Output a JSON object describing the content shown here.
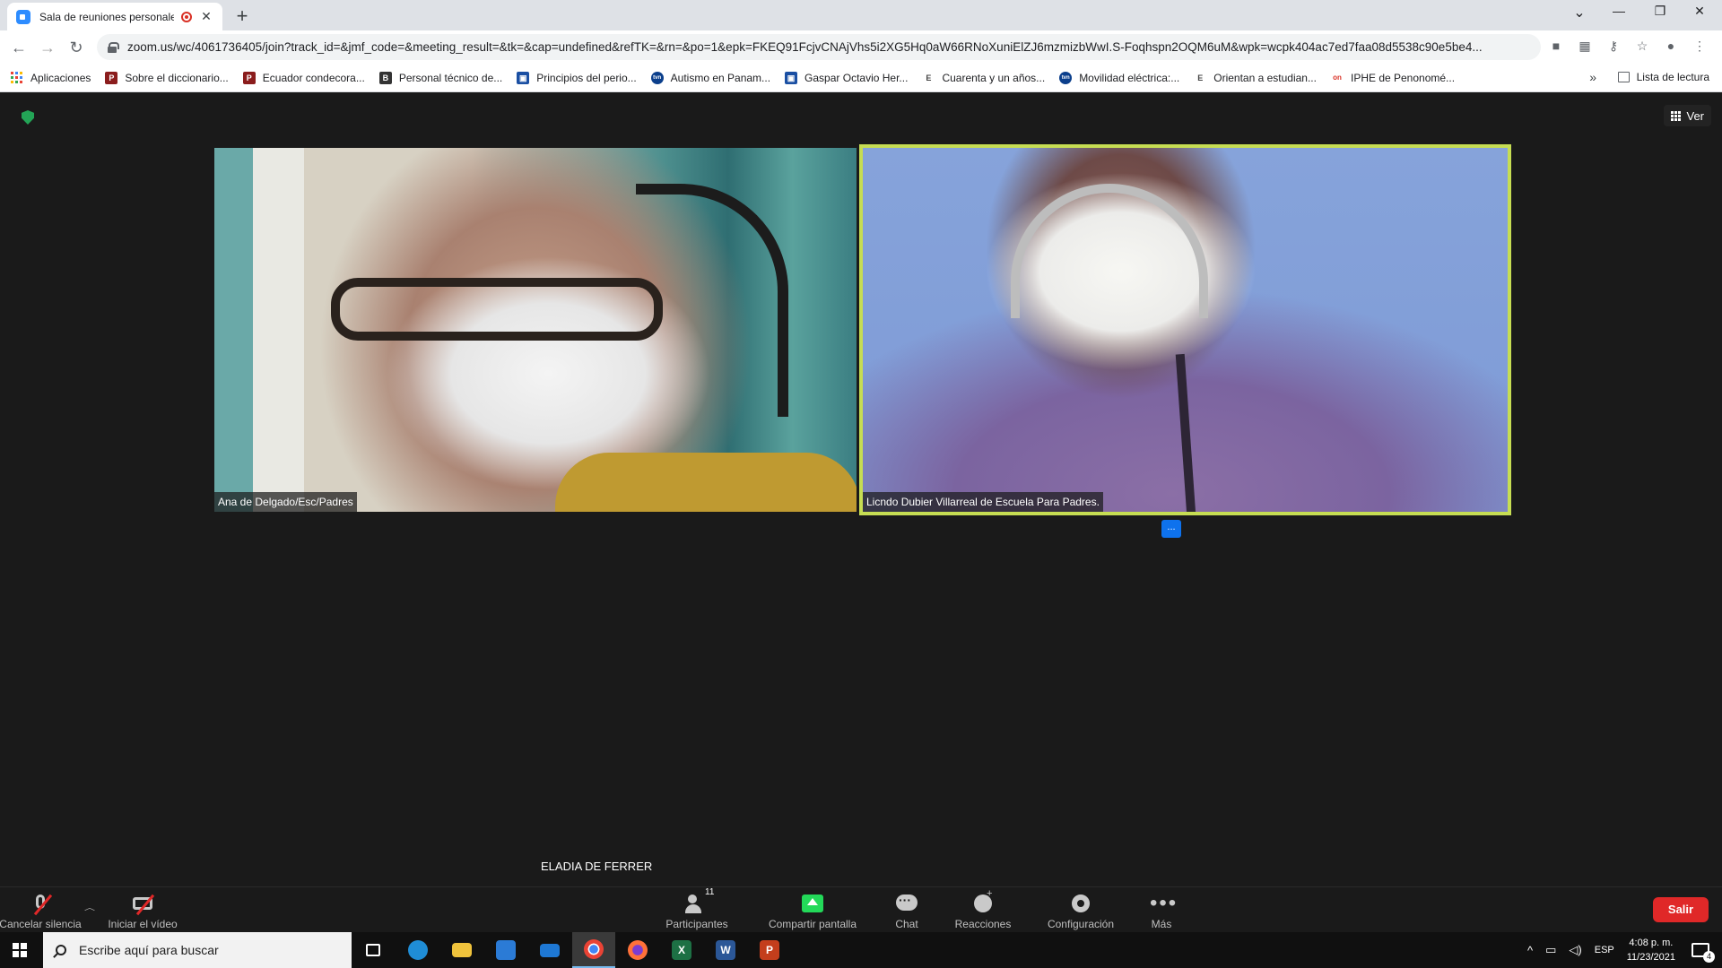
{
  "browser": {
    "tab_title": "Sala de reuniones personales",
    "url": "zoom.us/wc/4061736405/join?track_id=&jmf_code=&meeting_result=&tk=&cap=undefined&refTK=&rn=&po=1&epk=FKEQ91FcjvCNAjVhs5i2XG5Hq0aW66RNoXuniElZJ6mzmizbWwI.S-Foqhspn2OQM6uM&wpk=wcpk404ac7ed7faa08d5538c90e5be4...",
    "bookmarks": [
      {
        "label": "Aplicaciones",
        "icon": "apps-icon"
      },
      {
        "label": "Sobre el diccionario...",
        "icon": "P",
        "color": "#8b1d1d"
      },
      {
        "label": "Ecuador condecora...",
        "icon": "P",
        "color": "#8b1d1d"
      },
      {
        "label": "Personal técnico de...",
        "icon": "B",
        "color": "#333333"
      },
      {
        "label": "Principios del perio...",
        "icon": "▣",
        "color": "#1a4fa3"
      },
      {
        "label": "Autismo en Panam...",
        "icon": "tvn",
        "color": "#0b3f8c"
      },
      {
        "label": "Gaspar Octavio Her...",
        "icon": "▣",
        "color": "#1a4fa3"
      },
      {
        "label": "Cuarenta y un años...",
        "icon": "E",
        "color": "#444444"
      },
      {
        "label": "Movilidad eléctrica:...",
        "icon": "tvn",
        "color": "#0b3f8c"
      },
      {
        "label": "Orientan a estudian...",
        "icon": "E",
        "color": "#444444"
      },
      {
        "label": "IPHE de Penonomé...",
        "icon": "on",
        "color": "#d93025"
      }
    ],
    "reading_list": "Lista de lectura",
    "more_bookmarks": "»"
  },
  "meeting": {
    "view_label": "Ver",
    "participants": [
      {
        "name": "Ana de Delgado/Esc/Padres"
      },
      {
        "name": "Licndo Dubier Villarreal de Escuela Para Padres."
      }
    ],
    "more_chip": "...",
    "active_speaker": "ELADIA DE FERRER",
    "toolbar": {
      "mute": "Cancelar silencia",
      "video": "Iniciar el vídeo",
      "participants": "Participantes",
      "participants_count": "11",
      "share": "Compartir pantalla",
      "chat": "Chat",
      "reactions": "Reacciones",
      "settings": "Configuración",
      "more": "Más",
      "leave": "Salir"
    }
  },
  "taskbar": {
    "search_placeholder": "Escribe aquí para buscar",
    "language": "ESP",
    "time": "4:08 p. m.",
    "date": "11/23/2021",
    "notification_count": "4"
  }
}
